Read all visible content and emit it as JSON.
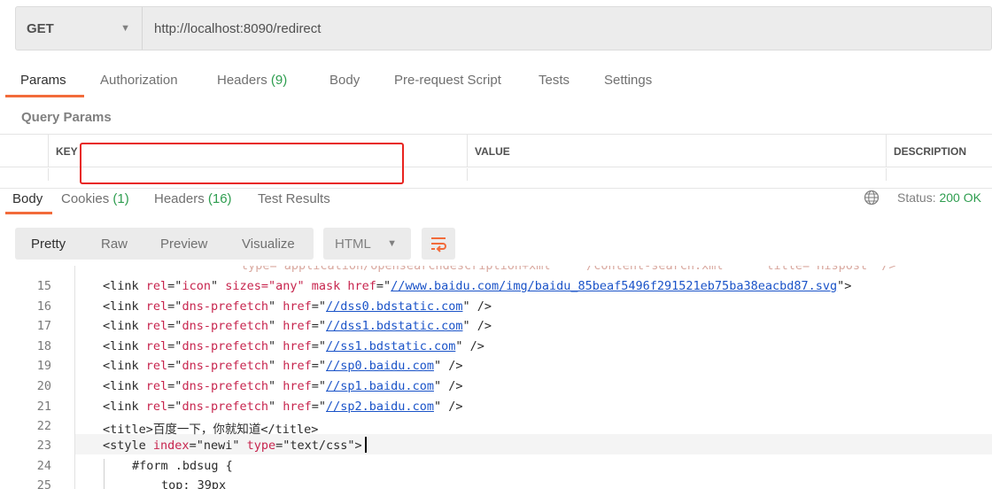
{
  "request": {
    "method": "GET",
    "url": "http://localhost:8090/redirect"
  },
  "request_tabs": [
    {
      "label": "Params",
      "count": "",
      "active": true
    },
    {
      "label": "Authorization",
      "count": "",
      "active": false
    },
    {
      "label": "Headers",
      "count": "(9)",
      "active": false
    },
    {
      "label": "Body",
      "count": "",
      "active": false
    },
    {
      "label": "Pre-request Script",
      "count": "",
      "active": false
    },
    {
      "label": "Tests",
      "count": "",
      "active": false
    },
    {
      "label": "Settings",
      "count": "",
      "active": false
    }
  ],
  "query_params": {
    "title": "Query Params",
    "columns": [
      "KEY",
      "VALUE",
      "DESCRIPTION"
    ]
  },
  "response_tabs": [
    {
      "label": "Body",
      "count": "",
      "active": true
    },
    {
      "label": "Cookies",
      "count": "(1)",
      "active": false
    },
    {
      "label": "Headers",
      "count": "(16)",
      "active": false
    },
    {
      "label": "Test Results",
      "count": "",
      "active": false
    }
  ],
  "status": {
    "label": "Status:",
    "value": "200 OK"
  },
  "view_modes": [
    "Pretty",
    "Raw",
    "Preview",
    "Visualize"
  ],
  "active_view": "Pretty",
  "format": "HTML",
  "icons": {
    "method_caret": "chevron-down-icon",
    "globe": "globe-icon",
    "wrap": "wrap-lines-icon"
  },
  "accent_color": "#f26b3a",
  "success_color": "#2e9d4f",
  "annotation_color": "#e8231e",
  "code_lines": [
    {
      "n": "15",
      "rel": "icon",
      "extra": " sizes=\"any\" mask",
      "href": "//www.baidu.com/img/baidu_85beaf5496f291521eb75ba38eacbd87.svg",
      "close": ">"
    },
    {
      "n": "16",
      "rel": "dns-prefetch",
      "extra": "",
      "href": "//dss0.bdstatic.com",
      "close": " />"
    },
    {
      "n": "17",
      "rel": "dns-prefetch",
      "extra": "",
      "href": "//dss1.bdstatic.com",
      "close": " />"
    },
    {
      "n": "18",
      "rel": "dns-prefetch",
      "extra": "",
      "href": "//ss1.bdstatic.com",
      "close": " />"
    },
    {
      "n": "19",
      "rel": "dns-prefetch",
      "extra": "",
      "href": "//sp0.baidu.com",
      "close": " />"
    },
    {
      "n": "20",
      "rel": "dns-prefetch",
      "extra": "",
      "href": "//sp1.baidu.com",
      "close": " />"
    },
    {
      "n": "21",
      "rel": "dns-prefetch",
      "extra": "",
      "href": "//sp2.baidu.com",
      "close": " />"
    }
  ],
  "line22": {
    "n": "22",
    "open": "<title>",
    "text": "百度一下，你就知道",
    "close": "</title>"
  },
  "line23": {
    "n": "23",
    "open": "<style",
    "attr1": " index",
    "val1": "=\"newi\"",
    "attr2": " type",
    "val2": "=\"text/css\"",
    "close": ">"
  },
  "line24": {
    "n": "24",
    "text": "#form .bdsug {"
  },
  "line25": {
    "n": "25",
    "text": "top: 39px"
  }
}
